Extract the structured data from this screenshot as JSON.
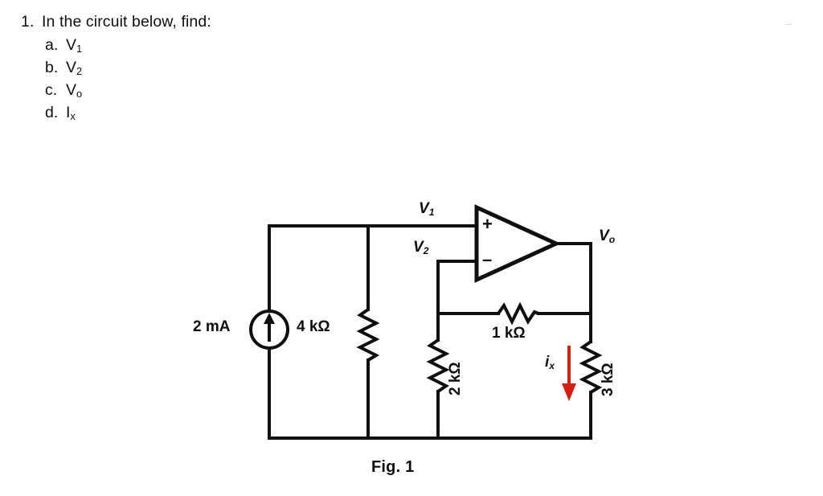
{
  "question": {
    "number": "1.",
    "prompt": "In the circuit below, find:",
    "parts": [
      {
        "letter": "a.",
        "symbol": "V",
        "subscript": "1"
      },
      {
        "letter": "b.",
        "symbol": "V",
        "subscript": "2"
      },
      {
        "letter": "c.",
        "symbol": "V",
        "subscript": "o"
      },
      {
        "letter": "d.",
        "symbol": "I",
        "subscript": "x"
      }
    ]
  },
  "figure": {
    "caption": "Fig. 1",
    "labels": {
      "source": "2 mA",
      "r4": "4 kΩ",
      "r2": "2 kΩ",
      "r1": "1 kΩ",
      "r3": "3 kΩ",
      "v1": "V",
      "v1_sub": "1",
      "v2": "V",
      "v2_sub": "2",
      "vo": "V",
      "vo_sub": "o",
      "ix": "i",
      "ix_sub": "x",
      "op_plus": "+",
      "op_minus": "–"
    },
    "colors": {
      "wire": "#0f0f10",
      "text": "#0f0f10",
      "current_arrow": "#d81f12",
      "background": "#ffffff"
    }
  },
  "chart_data": {
    "type": "diagram",
    "title": "Fig. 1",
    "description": "Op-amp circuit: 2 mA current source in parallel with 4 kΩ to the non-inverting input node V1; inverting input V2 connects to 2 kΩ to ground and through 1 kΩ feedback to output Vo; 3 kΩ load from Vo to ground carrying current ix downward.",
    "components": [
      {
        "name": "current-source",
        "value": "2 mA",
        "type": "independent current source",
        "orientation": "vertical",
        "arrow": "up"
      },
      {
        "name": "resistor-4k",
        "value": "4 kΩ",
        "type": "resistor",
        "orientation": "vertical"
      },
      {
        "name": "resistor-2k",
        "value": "2 kΩ",
        "type": "resistor",
        "orientation": "vertical"
      },
      {
        "name": "resistor-1k",
        "value": "1 kΩ",
        "type": "resistor",
        "orientation": "horizontal"
      },
      {
        "name": "resistor-3k",
        "value": "3 kΩ",
        "type": "resistor",
        "orientation": "vertical"
      },
      {
        "name": "op-amp",
        "value": "",
        "type": "operational amplifier",
        "orientation": "apex-right"
      }
    ],
    "nodes": [
      "V1",
      "V2",
      "Vo",
      "ground"
    ],
    "currents": [
      {
        "name": "ix",
        "direction": "down",
        "through": "resistor-3k"
      }
    ]
  }
}
